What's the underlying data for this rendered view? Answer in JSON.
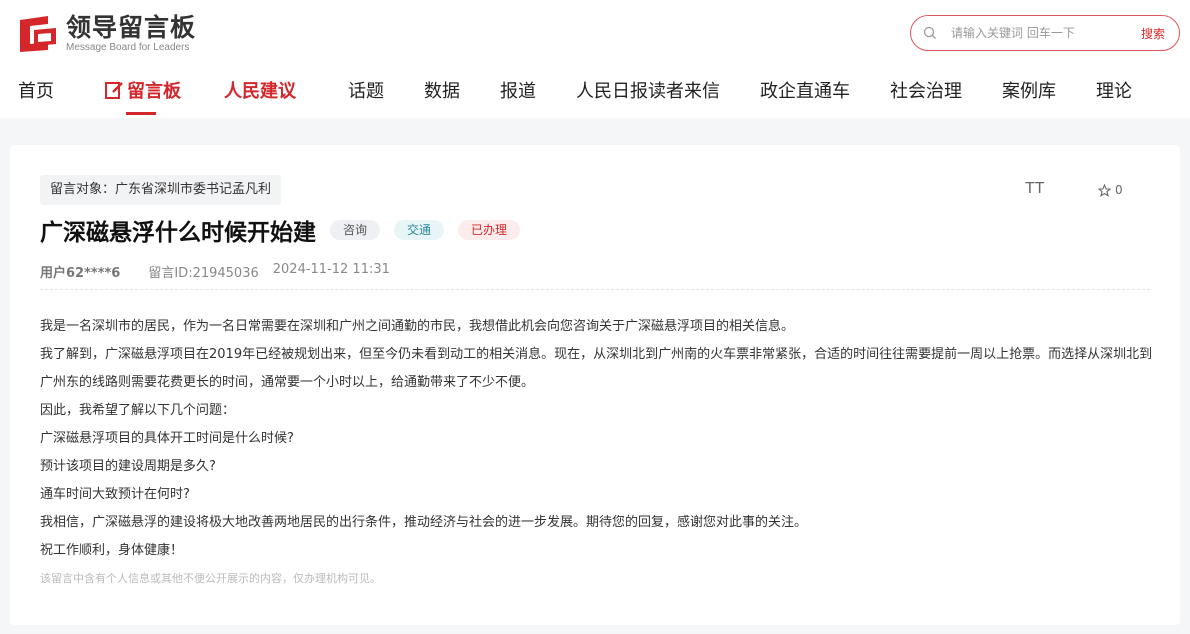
{
  "header": {
    "logo_cn": "领导留言板",
    "logo_en": "Message Board for Leaders",
    "search_placeholder": "请输入关键词 回车一下",
    "search_button": "搜索"
  },
  "nav": [
    {
      "label": "首页"
    },
    {
      "label": "留言板",
      "active": true
    },
    {
      "label": "人民建议"
    },
    {
      "label": "话题"
    },
    {
      "label": "数据"
    },
    {
      "label": "报道"
    },
    {
      "label": "人民日报读者来信"
    },
    {
      "label": "政企直通车"
    },
    {
      "label": "社会治理"
    },
    {
      "label": "案例库"
    },
    {
      "label": "理论"
    }
  ],
  "message": {
    "target": "留言对象：广东省深圳市委书记孟凡利",
    "font_toggle": "TT",
    "favorite_count": "0",
    "title": "广深磁悬浮什么时候开始建",
    "tags": [
      "咨询",
      "交通",
      "已办理"
    ],
    "user": "用户62****6",
    "message_id": "留言ID:21945036",
    "time": "2024-11-12 11:31",
    "paragraphs": [
      "我是一名深圳市的居民，作为一名日常需要在深圳和广州之间通勤的市民，我想借此机会向您咨询关于广深磁悬浮项目的相关信息。",
      "我了解到，广深磁悬浮项目在2019年已经被规划出来，但至今仍未看到动工的相关消息。现在，从深圳北到广州南的火车票非常紧张，合适的时间往往需要提前一周以上抢票。而选择从深圳北到广州东的线路则需要花费更长的时间，通常要一个小时以上，给通勤带来了不少不便。",
      "因此，我希望了解以下几个问题：",
      "广深磁悬浮项目的具体开工时间是什么时候?",
      "预计该项目的建设周期是多久?",
      "通车时间大致预计在何时?",
      "我相信，广深磁悬浮的建设将极大地改善两地居民的出行条件，推动经济与社会的进一步发展。期待您的回复，感谢您对此事的关注。",
      "祝工作顺利，身体健康！"
    ],
    "privacy_note": "该留言中含有个人信息或其他不便公开展示的内容，仅办理机构可见。"
  },
  "colors": {
    "brand_red": "#d4272b",
    "page_bg": "#f5f6f7"
  }
}
